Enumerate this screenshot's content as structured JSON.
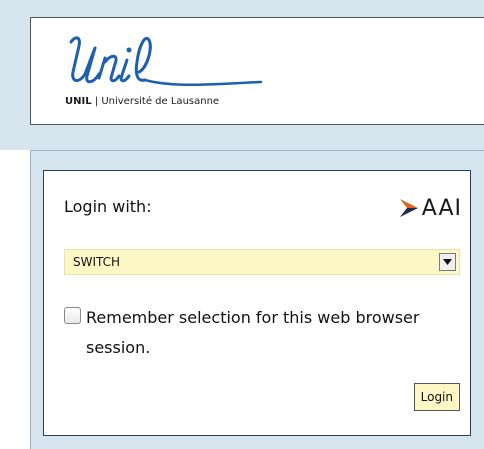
{
  "header": {
    "logo_brand": "UNIL",
    "logo_separator": " | ",
    "logo_university": "Université de Lausanne"
  },
  "login": {
    "heading": "Login with:",
    "provider_logo_text": "AAI",
    "selected_provider": "SWITCH",
    "remember_label": "Remember selection for this web browser session.",
    "remember_checked": false,
    "login_button_label": "Login"
  },
  "colors": {
    "band": "#d6e4ee",
    "logo_blue": "#1f5fb0",
    "select_bg": "#fdf7c6",
    "box_border": "#2a3f63"
  },
  "icons": {
    "provider": "aai-arrow-icon",
    "dropdown": "dropdown-arrow-icon"
  }
}
